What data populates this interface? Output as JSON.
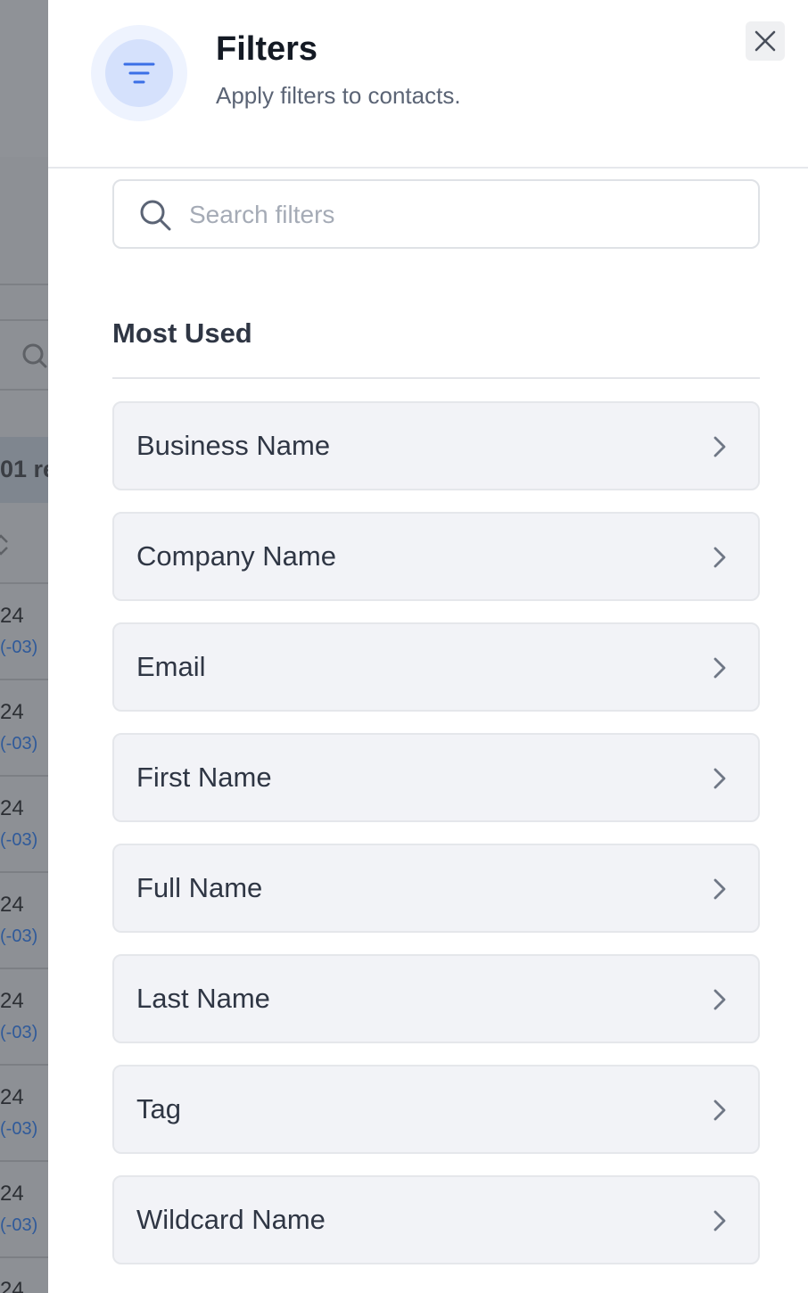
{
  "background": {
    "record_count_fragment": "01 re",
    "rows": [
      {
        "year_fragment": "24",
        "tz_fragment": "(-03)"
      },
      {
        "year_fragment": "24",
        "tz_fragment": "(-03)"
      },
      {
        "year_fragment": "24",
        "tz_fragment": "(-03)"
      },
      {
        "year_fragment": "24",
        "tz_fragment": "(-03)"
      },
      {
        "year_fragment": "24",
        "tz_fragment": "(-03)"
      },
      {
        "year_fragment": "24",
        "tz_fragment": "(-03)"
      },
      {
        "year_fragment": "24",
        "tz_fragment": "(-03)"
      },
      {
        "year_fragment": "24",
        "tz_fragment": ""
      }
    ]
  },
  "drawer": {
    "title": "Filters",
    "subtitle": "Apply filters to contacts.",
    "header_icon": "filter-lines-icon",
    "close_icon": "close-icon"
  },
  "search": {
    "placeholder": "Search filters",
    "value": "",
    "icon": "search-icon"
  },
  "section": {
    "title": "Most Used"
  },
  "filters": [
    {
      "label": "Business Name"
    },
    {
      "label": "Company Name"
    },
    {
      "label": "Email"
    },
    {
      "label": "First Name"
    },
    {
      "label": "Full Name"
    },
    {
      "label": "Last Name"
    },
    {
      "label": "Tag"
    },
    {
      "label": "Wildcard Name"
    }
  ],
  "colors": {
    "accent": "#3b6fe6",
    "icon_bg_outer": "#eef3fe",
    "icon_bg_inner": "#d5e1fc",
    "item_bg": "#f2f3f7",
    "overlay": "#8d9095"
  }
}
